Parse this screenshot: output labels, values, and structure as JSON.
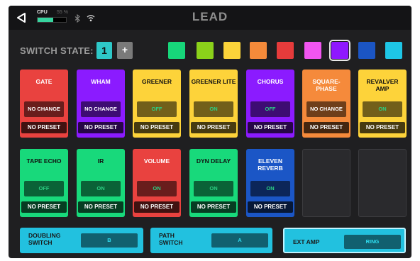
{
  "topbar": {
    "cpu_label": "CPU",
    "cpu_percent_text": "55 %",
    "cpu_usage": 0.55,
    "title": "LEAD"
  },
  "switch_state": {
    "label": "SWITCH STATE:",
    "number": "1",
    "add_label": "+",
    "colors": [
      "#17d67a",
      "#8bd11a",
      "#fbd33a",
      "#f48a3a",
      "#e63b3b",
      "#f155f0",
      "#8f18ff",
      "#1b55c4",
      "#1ec6e6"
    ],
    "selected_color_index": 6
  },
  "blocks": [
    {
      "name": "GATE",
      "state": "NO CHANGE",
      "preset": "NO PRESET",
      "color": "#e9423f",
      "text_color": "#ffffff",
      "state_color": "#ffffff"
    },
    {
      "name": "WHAM",
      "state": "NO CHANGE",
      "preset": "NO PRESET",
      "color": "#8b1bff",
      "text_color": "#ffffff",
      "state_color": "#ffffff"
    },
    {
      "name": "GREENER",
      "state": "OFF",
      "preset": "NO PRESET",
      "color": "#fdd33a",
      "text_color": "#111111",
      "state_color": "#2ccf83"
    },
    {
      "name": "GREENER LITE",
      "state": "ON",
      "preset": "NO PRESET",
      "color": "#fdd33a",
      "text_color": "#111111",
      "state_color": "#2ccf83"
    },
    {
      "name": "CHORUS",
      "state": "OFF",
      "preset": "NO PRESET",
      "color": "#8b1bff",
      "text_color": "#ffffff",
      "state_color": "#2ccf83"
    },
    {
      "name": "SQUARE-PHASE",
      "state": "NO CHANGE",
      "preset": "NO PRESET",
      "color": "#f58a3b",
      "text_color": "#ffffff",
      "state_color": "#ffffff"
    },
    {
      "name": "REVALVER AMP",
      "state": "ON",
      "preset": "NO PRESET",
      "color": "#fdd33a",
      "text_color": "#111111",
      "state_color": "#2ccf83"
    },
    {
      "name": "TAPE ECHO",
      "state": "OFF",
      "preset": "NO PRESET",
      "color": "#18d97b",
      "text_color": "#111111",
      "state_color": "#2ccf83"
    },
    {
      "name": "IR",
      "state": "ON",
      "preset": "NO PRESET",
      "color": "#18d97b",
      "text_color": "#111111",
      "state_color": "#2ccf83"
    },
    {
      "name": "VOLUME",
      "state": "ON",
      "preset": "NO PRESET",
      "color": "#e9423f",
      "text_color": "#ffffff",
      "state_color": "#2ccf83"
    },
    {
      "name": "DYN DELAY",
      "state": "ON",
      "preset": "NO PRESET",
      "color": "#18d97b",
      "text_color": "#111111",
      "state_color": "#2ccf83"
    },
    {
      "name": "ELEVEN REVERB",
      "state": "ON",
      "preset": "NO PRESET",
      "color": "#1b56c6",
      "text_color": "#ffffff",
      "state_color": "#2ccf83"
    }
  ],
  "footswitches": [
    {
      "label_line1": "DOUBLING",
      "label_line2": "SWITCH",
      "value": "B"
    },
    {
      "label_line1": "PATH",
      "label_line2": "SWITCH",
      "value": "A"
    },
    {
      "label_line1": "EXT AMP",
      "label_line2": "",
      "value": "RING"
    }
  ]
}
